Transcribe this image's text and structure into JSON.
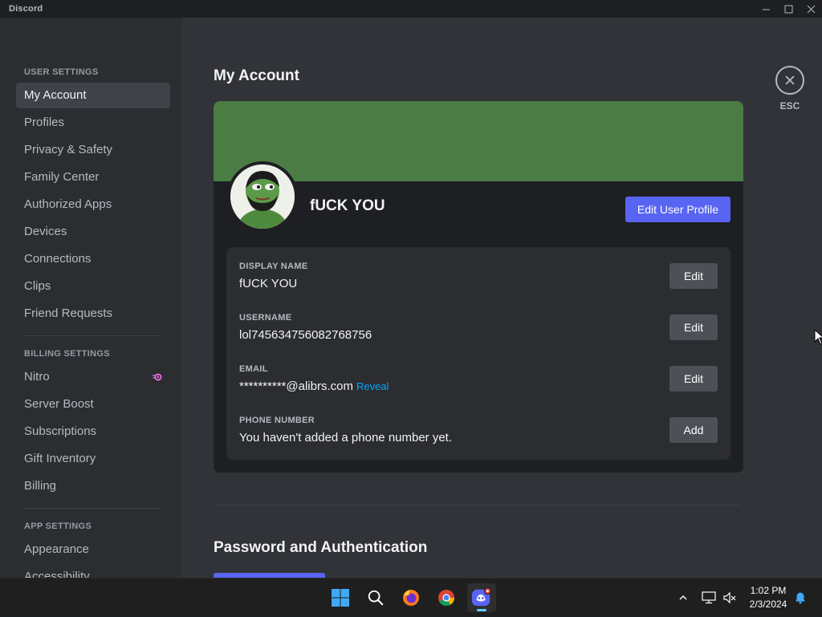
{
  "window": {
    "title": "Discord",
    "minimize_icon": "minimize-icon",
    "maximize_icon": "maximize-icon",
    "close_icon": "close-icon"
  },
  "sidebar": {
    "user_settings_header": "USER SETTINGS",
    "user_items": [
      {
        "label": "My Account",
        "active": true
      },
      {
        "label": "Profiles"
      },
      {
        "label": "Privacy & Safety"
      },
      {
        "label": "Family Center"
      },
      {
        "label": "Authorized Apps"
      },
      {
        "label": "Devices"
      },
      {
        "label": "Connections"
      },
      {
        "label": "Clips"
      },
      {
        "label": "Friend Requests"
      }
    ],
    "billing_settings_header": "BILLING SETTINGS",
    "billing_items": [
      {
        "label": "Nitro",
        "icon": "nitro-icon"
      },
      {
        "label": "Server Boost"
      },
      {
        "label": "Subscriptions"
      },
      {
        "label": "Gift Inventory"
      },
      {
        "label": "Billing"
      }
    ],
    "app_settings_header": "APP SETTINGS",
    "app_items": [
      {
        "label": "Appearance"
      },
      {
        "label": "Accessibility"
      }
    ]
  },
  "main": {
    "page_title": "My Account",
    "close": {
      "icon": "close-icon",
      "label": "ESC"
    },
    "profile": {
      "banner_color": "#4a7c43",
      "avatar_icon": "avatar-pepe",
      "display_name": "fUCK YOU",
      "edit_profile_label": "Edit User Profile"
    },
    "fields": [
      {
        "label": "DISPLAY NAME",
        "value": "fUCK YOU",
        "button": "Edit"
      },
      {
        "label": "USERNAME",
        "value": "lol745634756082768756",
        "button": "Edit"
      },
      {
        "label": "EMAIL",
        "value": "**********@alibrs.com",
        "link": "Reveal",
        "button": "Edit"
      },
      {
        "label": "PHONE NUMBER",
        "value": "You haven't added a phone number yet.",
        "button": "Add"
      }
    ],
    "password_section_title": "Password and Authentication"
  },
  "taskbar": {
    "apps": [
      {
        "name": "start-icon"
      },
      {
        "name": "search-icon"
      },
      {
        "name": "firefox-icon"
      },
      {
        "name": "chrome-icon"
      },
      {
        "name": "discord-icon",
        "active": true
      }
    ],
    "tray_icons": [
      "chevron-up-icon",
      "network-icon",
      "volume-muted-icon",
      "notification-bell-icon"
    ],
    "time": "1:02 PM",
    "date": "2/3/2024"
  },
  "colors": {
    "accent": "#5865f2",
    "link": "#00a8fc",
    "banner": "#4a7c43"
  }
}
